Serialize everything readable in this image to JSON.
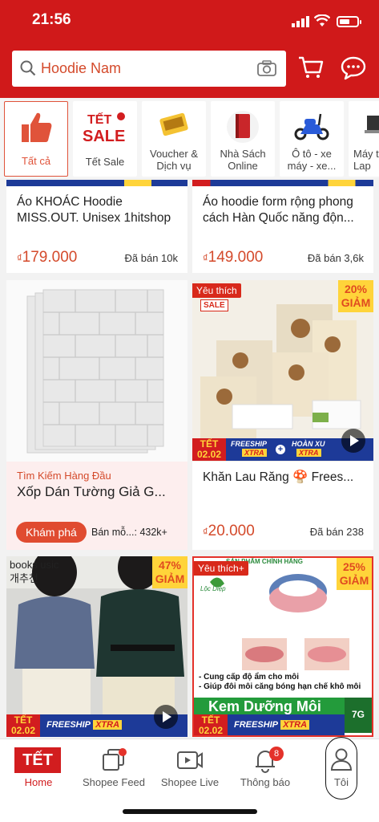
{
  "status": {
    "time": "21:56"
  },
  "search": {
    "query": "Hoodie Nam"
  },
  "categories": [
    {
      "label": "Tất cả",
      "icon": "thumbs-up-icon",
      "active": true
    },
    {
      "label": "Tết Sale",
      "icon": "tet-sale-icon"
    },
    {
      "label": "Voucher &\nDịch vụ",
      "icon": "voucher-icon"
    },
    {
      "label": "Nhà Sách\nOnline",
      "icon": "book-icon"
    },
    {
      "label": "Ô tô - xe\nmáy - xe...",
      "icon": "scooter-icon"
    },
    {
      "label": "Máy t\nLap",
      "icon": "laptop-icon"
    }
  ],
  "products": [
    {
      "title": "Áo KHOÁC Hoodie MISS.OUT. Unisex 1hitshop",
      "currency": "₫",
      "price": "179.000",
      "sold": "Đã bán 10k"
    },
    {
      "title": "Áo hoodie form rộng phong cách Hàn Quốc năng độn...",
      "currency": "₫",
      "price": "149.000",
      "sold": "Đã bán 3,6k"
    },
    {
      "title": "Xốp Dán Tường Giả G...",
      "top_label": "Tìm Kiếm Hàng Đầu",
      "explore": "Khám phá",
      "sold": "Bán mỗ...: 432k+"
    },
    {
      "title": "Khăn Lau Răng 🍄 Frees...",
      "badge": "Yêu thích",
      "sale": "SALE",
      "discount_pct": "20%",
      "discount_word": "GIẢM",
      "currency": "₫",
      "price": "20.000",
      "sold": "Đã bán 238"
    },
    {
      "title": "",
      "discount_pct": "47%",
      "discount_word": "GIẢM",
      "overlay_text": "books  usic\n개추천"
    },
    {
      "title": "",
      "badge": "Yêu thích+",
      "top_banner": "SẢN PHẨM CHÍNH HÃNG",
      "discount_pct": "25%",
      "discount_word": "GIẢM",
      "bullets": "- Cung cấp độ ẩm cho môi\n- Giúp đôi môi căng bóng hạn chế khô môi",
      "banner": "Kem Dưỡng Môi",
      "size": "7G",
      "brand": "Lộc Diệp"
    }
  ],
  "promo": {
    "tet": "TẾT\n02.02",
    "freeship": "FREESHIP",
    "xtra": "XTRA",
    "hoanxu": "HOÀN XU"
  },
  "nav": [
    {
      "label": "Home",
      "active": true,
      "icon": "tet-home-icon"
    },
    {
      "label": "Shopee Feed",
      "icon": "feed-icon"
    },
    {
      "label": "Shopee Live",
      "icon": "live-icon"
    },
    {
      "label": "Thông báo",
      "icon": "bell-icon",
      "badge": "8"
    },
    {
      "label": "Tôi",
      "icon": "user-icon"
    }
  ],
  "colors": {
    "brand": "#d0191a",
    "accent": "#d44a2b"
  }
}
